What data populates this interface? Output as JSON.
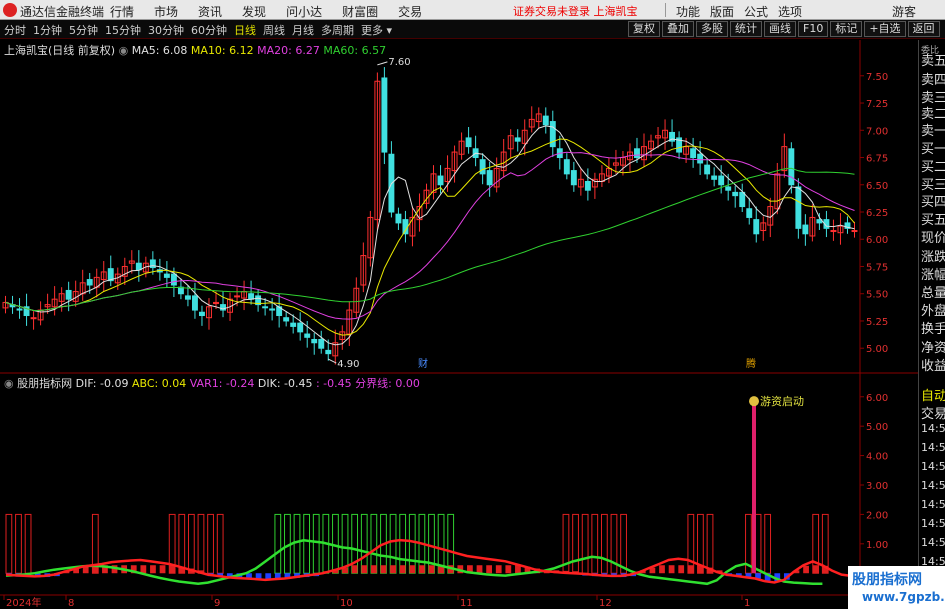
{
  "titlebar": {
    "app_name": "通达信金融终端",
    "menu": [
      "行情",
      "市场",
      "资讯",
      "发现",
      "问小达",
      "财富圈",
      "交易"
    ],
    "warning": "证券交易未登录 上海凯宝",
    "right_menu": [
      "功能",
      "版面",
      "公式",
      "选项"
    ],
    "guest": "游客"
  },
  "toolbar": {
    "periods": [
      "分时",
      "1分钟",
      "5分钟",
      "15分钟",
      "30分钟",
      "60分钟",
      "日线",
      "周线",
      "月线",
      "多周期",
      "更多"
    ],
    "active_period": "日线",
    "tools": [
      "复权",
      "叠加",
      "多股",
      "统计",
      "画线",
      "F10",
      "标记",
      "+自选",
      "返回"
    ]
  },
  "main_chart": {
    "stock_title": "上海凯宝(日线 前复权)",
    "ma": [
      {
        "label": "MA5: 6.08",
        "color": "#e0e0e0"
      },
      {
        "label": "MA10: 6.12",
        "color": "#e8e800"
      },
      {
        "label": "MA20: 6.27",
        "color": "#e040e0"
      },
      {
        "label": "MA60: 6.57",
        "color": "#30d030"
      }
    ],
    "price_axis": [
      "7.50",
      "7.25",
      "7.00",
      "6.75",
      "6.50",
      "6.25",
      "6.00",
      "5.75",
      "5.50",
      "5.25",
      "5.00"
    ],
    "high_label": "7.60",
    "low_label": "4.90",
    "markers": [
      "财",
      "腾"
    ],
    "colors": {
      "up": "#ff3030",
      "down": "#40e0e0"
    }
  },
  "indicator": {
    "name": "股朋指标网",
    "values": [
      {
        "label": "DIF: -0.09",
        "color": "#e0e0e0"
      },
      {
        "label": "ABC: 0.04",
        "color": "#e8e800"
      },
      {
        "label": "VAR1: -0.24",
        "color": "#e040e0"
      },
      {
        "label": "DIK: -0.45",
        "color": "#e0e0e0"
      },
      {
        "label": ": -0.45",
        "color": "#e040e0"
      },
      {
        "label": "分界线: 0.00",
        "color": "#e040e0"
      }
    ],
    "axis": [
      "6.00",
      "5.00",
      "4.00",
      "3.00",
      "2.00",
      "1.00"
    ],
    "signal_label": "游资启动"
  },
  "date_axis": [
    "2024年",
    "8",
    "9",
    "10",
    "11",
    "12",
    "1"
  ],
  "right_panel": {
    "top": "委比",
    "items": [
      "卖五",
      "卖四",
      "卖三",
      "卖二",
      "卖一",
      "买一",
      "买二",
      "买三",
      "买四",
      "买五",
      "现价",
      "涨跌",
      "涨幅",
      "总量",
      "外盘",
      "换手",
      "净资",
      "收益"
    ],
    "lower": [
      "自动",
      "交易"
    ],
    "times": [
      "14:56",
      "14:56",
      "14:56",
      "14:56",
      "14:56",
      "14:56",
      "14:56",
      "14:56",
      "14:56"
    ]
  },
  "watermark": {
    "line1": "股朋指标网",
    "line2": "www.7gpzb.com"
  },
  "series": {
    "closes": [
      5.42,
      5.38,
      5.35,
      5.3,
      5.28,
      5.35,
      5.4,
      5.45,
      5.5,
      5.45,
      5.52,
      5.6,
      5.58,
      5.65,
      5.7,
      5.62,
      5.68,
      5.75,
      5.8,
      5.72,
      5.78,
      5.74,
      5.7,
      5.65,
      5.58,
      5.5,
      5.45,
      5.35,
      5.3,
      5.38,
      5.42,
      5.35,
      5.45,
      5.48,
      5.52,
      5.45,
      5.4,
      5.38,
      5.35,
      5.3,
      5.25,
      5.2,
      5.15,
      5.1,
      5.05,
      5.0,
      4.95,
      5.05,
      5.15,
      5.35,
      5.55,
      5.85,
      6.2,
      7.45,
      6.8,
      6.25,
      6.15,
      6.05,
      6.2,
      6.3,
      6.45,
      6.6,
      6.5,
      6.65,
      6.8,
      6.9,
      6.85,
      6.75,
      6.6,
      6.5,
      6.65,
      6.8,
      6.95,
      6.9,
      7.0,
      7.1,
      7.15,
      7.05,
      6.85,
      6.75,
      6.6,
      6.5,
      6.55,
      6.45,
      6.55,
      6.6,
      6.65,
      6.7,
      6.75,
      6.8,
      6.75,
      6.85,
      6.9,
      6.95,
      7.0,
      6.9,
      6.8,
      6.85,
      6.75,
      6.7,
      6.6,
      6.55,
      6.5,
      6.45,
      6.4,
      6.3,
      6.2,
      6.05,
      6.15,
      6.3,
      6.6,
      6.85,
      6.5,
      6.1,
      6.05,
      6.2,
      6.15,
      6.1,
      6.08,
      6.12,
      6.1,
      6.08
    ],
    "dif": [
      -0.05,
      -0.08,
      -0.1,
      -0.12,
      -0.1,
      -0.05,
      0.05,
      0.15,
      0.25,
      0.3,
      0.35,
      0.42,
      0.45,
      0.48,
      0.5,
      0.45,
      0.4,
      0.35,
      0.25,
      0.15,
      0.05,
      -0.05,
      -0.1,
      -0.15,
      -0.18,
      -0.2,
      -0.22,
      -0.25,
      -0.22,
      -0.2,
      -0.15,
      -0.1,
      -0.05,
      0.0,
      0.1,
      0.2,
      0.35,
      0.55,
      0.8,
      1.05,
      1.2,
      1.25,
      1.22,
      1.15,
      1.05,
      0.95,
      0.85,
      0.75,
      0.65,
      0.6,
      0.55,
      0.5,
      0.45,
      0.35,
      0.25,
      0.15,
      0.08,
      0.05,
      0.02,
      0.0,
      -0.02,
      -0.05,
      -0.08,
      -0.1,
      -0.1,
      -0.05,
      0.05,
      0.2,
      0.35,
      0.5,
      0.55,
      0.5,
      0.35,
      0.2,
      0.05,
      -0.05,
      -0.1,
      -0.15,
      -0.2,
      -0.3,
      -0.35,
      -0.25,
      0.05,
      0.3,
      0.45,
      0.3,
      0.1,
      -0.05,
      -0.1,
      -0.12,
      -0.09
    ],
    "dik": [
      -0.1,
      -0.08,
      -0.05,
      0.0,
      0.08,
      0.15,
      0.2,
      0.25,
      0.3,
      0.32,
      0.3,
      0.25,
      0.18,
      0.1,
      0.0,
      -0.1,
      -0.2,
      -0.28,
      -0.35,
      -0.4,
      -0.45,
      -0.4,
      -0.3,
      -0.2,
      -0.1,
      0.0,
      0.2,
      0.5,
      0.8,
      1.1,
      1.3,
      1.4,
      1.35,
      1.3,
      1.2,
      1.1,
      1.05,
      0.95,
      0.85,
      0.75,
      0.7,
      0.6,
      0.55,
      0.5,
      0.45,
      0.35,
      0.25,
      0.15,
      0.05,
      0.0,
      -0.05,
      -0.08,
      -0.1,
      -0.05,
      0.0,
      0.05,
      0.1,
      0.2,
      0.35,
      0.5,
      0.6,
      0.7,
      0.65,
      0.5,
      0.3,
      0.1,
      -0.05,
      -0.15,
      -0.2,
      -0.25,
      -0.3,
      -0.35,
      -0.4,
      -0.45,
      -0.3,
      0.05,
      0.3,
      0.4,
      0.2,
      0.0,
      -0.2,
      -0.35,
      -0.4,
      -0.42,
      -0.45,
      -0.45
    ]
  }
}
